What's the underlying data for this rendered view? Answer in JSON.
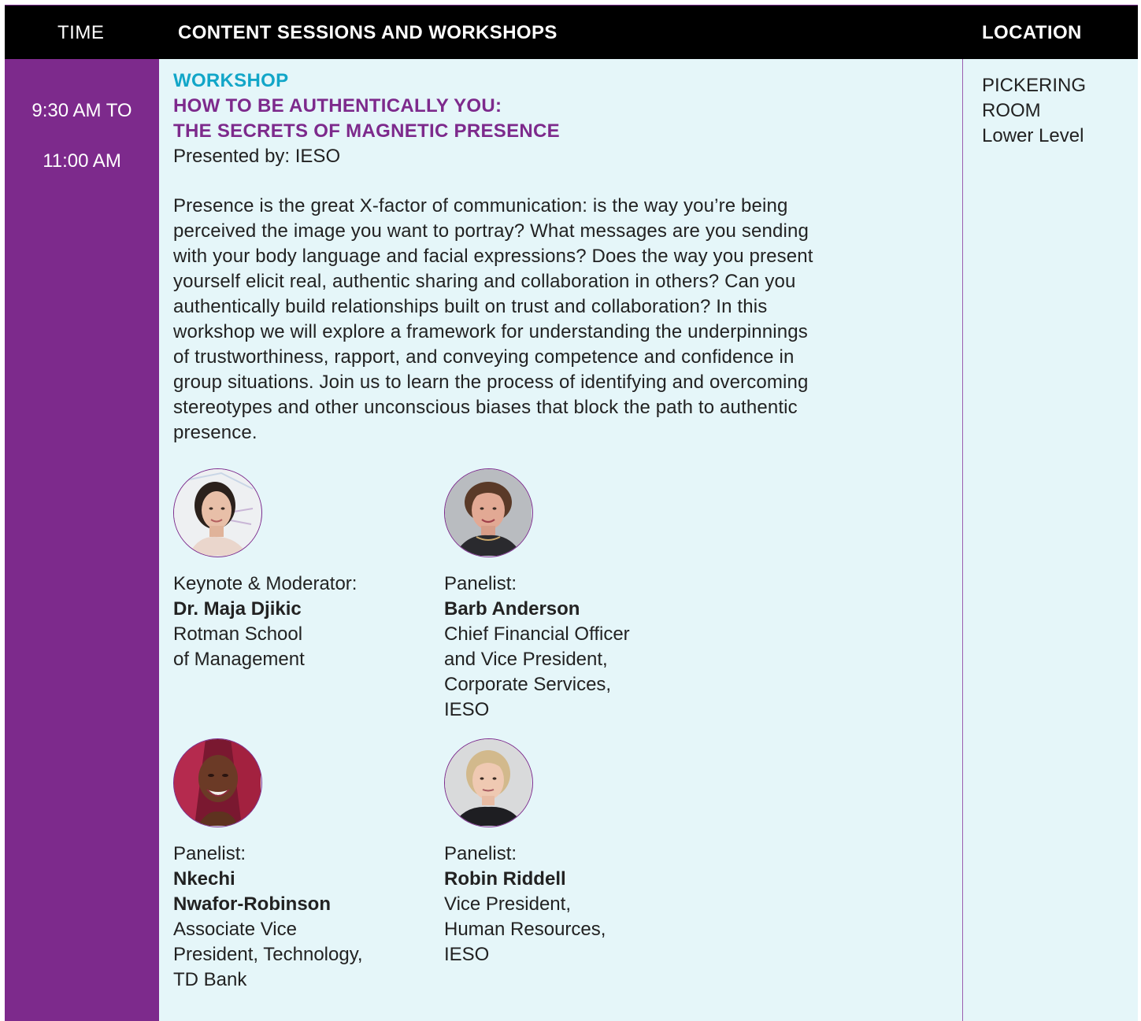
{
  "header": {
    "time_label": "TIME",
    "content_label": "CONTENT SESSIONS AND WORKSHOPS",
    "location_label": "LOCATION"
  },
  "session": {
    "time_lines": [
      "9:30 AM TO",
      "11:00 AM"
    ],
    "type": "WORKSHOP",
    "title_lines": [
      "HOW TO BE AUTHENTICALLY YOU:",
      "THE SECRETS OF MAGNETIC PRESENCE"
    ],
    "presented_by": "Presented by: IESO",
    "description_lines": [
      "Presence is the great X-factor of communication: is the way you’re being",
      "perceived the image you want to portray? What messages are you sending",
      "with your body language and facial expressions? Does the way you present",
      "yourself elicit real, authentic sharing and collaboration in others? Can you",
      "authentically build relationships built on trust and collaboration? In this",
      "workshop we will explore a framework for understanding the underpinnings",
      "of trustworthiness, rapport, and conveying competence and confidence in",
      "group situations. Join us to learn the process of identifying and overcoming",
      "stereotypes and other unconscious biases that block the path to authentic",
      "presence."
    ],
    "location_lines": [
      "PICKERING",
      "ROOM",
      "Lower Level"
    ]
  },
  "speakers": [
    {
      "role": "Keynote & Moderator:",
      "name_lines": [
        "Dr. Maja Djikic"
      ],
      "org_lines": [
        "Rotman School",
        "of Management"
      ]
    },
    {
      "role": "Panelist:",
      "name_lines": [
        "Barb Anderson"
      ],
      "org_lines": [
        "Chief Financial Officer",
        "and Vice President,",
        "Corporate Services,",
        "IESO"
      ]
    },
    {
      "role": "Panelist:",
      "name_lines": [
        "Nkechi",
        "Nwafor-Robinson"
      ],
      "org_lines": [
        "Associate Vice",
        "President, Technology,",
        "TD Bank"
      ]
    },
    {
      "role": "Panelist:",
      "name_lines": [
        "Robin Riddell"
      ],
      "org_lines": [
        "Vice President,",
        "Human Resources,",
        "IESO"
      ]
    }
  ],
  "colors": {
    "header_bg": "#000000",
    "time_column": "#7d2a8c",
    "content_bg": "#e5f6f9",
    "workshop_label": "#12a6c8",
    "title": "#7d2a8c"
  }
}
